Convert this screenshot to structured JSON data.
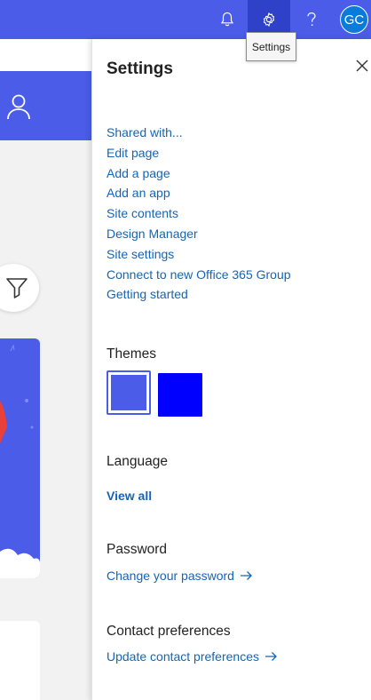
{
  "topbar": {
    "color": "#4a5ce8",
    "avatar_initials": "GC",
    "icons": [
      "bell-icon",
      "gear-icon",
      "help-icon"
    ]
  },
  "tooltip": {
    "text": "Settings"
  },
  "panel": {
    "title": "Settings",
    "links": [
      "Shared with...",
      "Edit page",
      "Add a page",
      "Add an app",
      "Site contents",
      "Design Manager",
      "Site settings",
      "Connect to new Office 365 Group",
      "Getting started"
    ],
    "themes": {
      "title": "Themes",
      "swatches": [
        {
          "color": "#4a5ce8",
          "selected": true
        },
        {
          "color": "#0000ff",
          "selected": false
        }
      ]
    },
    "language": {
      "title": "Language",
      "link": "View all"
    },
    "password": {
      "title": "Password",
      "link": "Change your password"
    },
    "contact": {
      "title": "Contact preferences",
      "link": "Update contact preferences"
    }
  }
}
